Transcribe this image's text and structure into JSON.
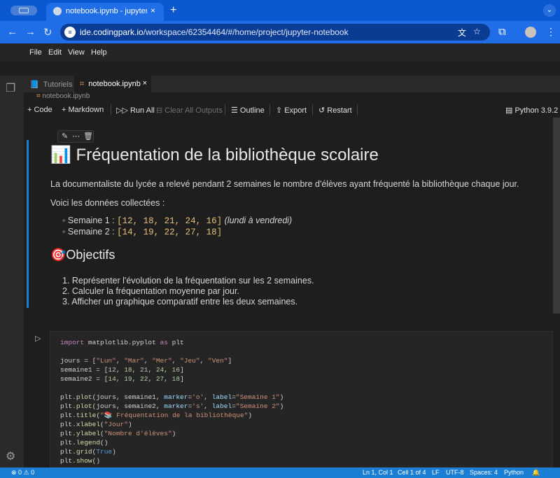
{
  "browser": {
    "tab_title": "notebook.ipynb - jupyter-noteb",
    "url_host": "ide.codingpark.io",
    "url_path": "/workspace/62354464/#/home/project/jupyter-notebook",
    "new_tab_icon": "+",
    "close_icon": "×"
  },
  "menu": [
    "File",
    "Edit",
    "View",
    "Help"
  ],
  "editor_tabs": {
    "inactive": "Tutoriels",
    "active": "notebook.ipynb",
    "close": "×"
  },
  "breadcrumb": "notebook.ipynb",
  "toolbar": {
    "code": "Code",
    "markdown": "Markdown",
    "run_all": "Run All",
    "clear_outputs": "Clear All Outputs",
    "outline": "Outline",
    "export": "Export",
    "restart": "Restart",
    "kernel": "Python 3.9.2"
  },
  "markdown_cell": {
    "title": "📊 Fréquentation de la bibliothèque scolaire",
    "intro": "La documentaliste du lycée a relevé pendant 2 semaines le nombre d'élèves ayant fréquenté la bibliothèque chaque jour.",
    "data_label": "Voici les données collectées :",
    "week1_label": "Semaine 1 :",
    "week1_values": "[12, 18, 21, 24, 16]",
    "week1_note": "(lundi à vendredi)",
    "week2_label": "Semaine 2 :",
    "week2_values": "[14, 19, 22, 27, 18]",
    "objectives_title": "🎯Objectifs",
    "objectives": [
      "1. Représenter l'évolution de la fréquentation sur les 2 semaines.",
      "2. Calculer la fréquentation moyenne par jour.",
      "3. Afficher un graphique comparatif entre les deux semaines."
    ]
  },
  "code_cell": {
    "lines": [
      "import matplotlib.pyplot as plt",
      "",
      "jours = [\"Lun\", \"Mar\", \"Mer\", \"Jeu\", \"Ven\"]",
      "semaine1 = [12, 18, 21, 24, 16]",
      "semaine2 = [14, 19, 22, 27, 18]",
      "",
      "plt.plot(jours, semaine1, marker='o', label=\"Semaine 1\")",
      "plt.plot(jours, semaine2, marker='s', label=\"Semaine 2\")",
      "plt.title(\"📚 Fréquentation de la bibliothèque\")",
      "plt.xlabel(\"Jour\")",
      "plt.ylabel(\"Nombre d'élèves\")",
      "plt.legend()",
      "plt.grid(True)",
      "plt.show()"
    ]
  },
  "statusbar": {
    "problems": "⊗ 0 ⚠ 0",
    "position": "Ln 1, Col 1",
    "cell": "Cell 1 of 4",
    "eol": "LF",
    "encoding": "UTF-8",
    "spaces": "Spaces: 4",
    "language": "Python"
  }
}
